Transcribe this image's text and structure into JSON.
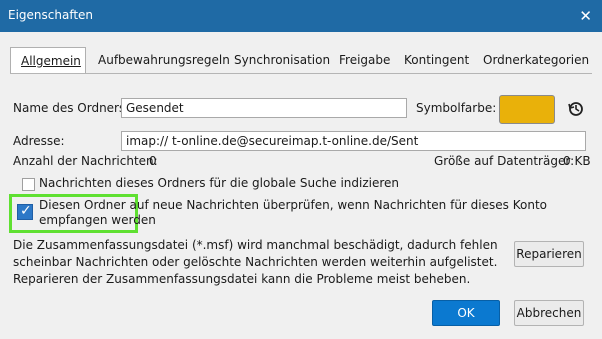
{
  "window": {
    "title": "Eigenschaften",
    "close_icon": "close-icon"
  },
  "tabs": [
    "Allgemein",
    "Aufbewahrungsregeln",
    "Synchronisation",
    "Freigabe",
    "Kontingent",
    "Ordnerkategorien"
  ],
  "form": {
    "folder_name_label": "Name des Ordners:",
    "folder_name_value": "Gesendet",
    "symbol_color_label": "Symbolfarbe:",
    "address_label": "Adresse:",
    "address_value": "imap://                            t-online.de@secureimap.t-online.de/Sent",
    "message_count_label": "Anzahl der Nachrichten:",
    "message_count_value": "0",
    "storage_label": "Größe auf Datenträger:",
    "storage_value": "0 KB",
    "color_accent": "#e9b10a"
  },
  "checkboxes": {
    "index_label": "Nachrichten dieses Ordners für die globale Suche indizieren",
    "check_new_label": "Diesen Ordner auf neue Nachrichten überprüfen, wenn Nachrichten für dieses Konto empfangen werden"
  },
  "info_text": "Die Zusammenfassungsdatei (*.msf) wird manchmal beschädigt, dadurch fehlen scheinbar Nachrichten oder gelöschte Nachrichten werden weiterhin aufgelistet. Reparieren der Zusammenfassungsdatei kann die Probleme meist beheben.",
  "buttons": {
    "repair": "Reparieren",
    "ok": "OK",
    "cancel": "Abbrechen"
  }
}
